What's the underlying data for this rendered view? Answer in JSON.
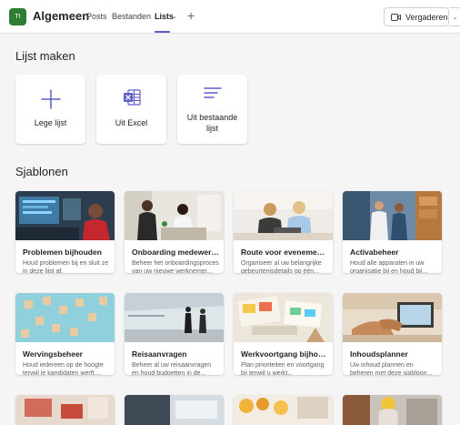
{
  "header": {
    "team_initials": "Tt",
    "channel_name": "Algemeen",
    "tabs": [
      "Posts",
      "Bestanden",
      "Lists"
    ],
    "meet_label": "Vergaderen"
  },
  "create": {
    "title": "Lijst maken",
    "options": [
      {
        "label": "Lege lijst",
        "icon": "plus-icon"
      },
      {
        "label": "Uit Excel",
        "icon": "excel-icon"
      },
      {
        "label": "Uit bestaande lijst",
        "icon": "list-icon"
      }
    ]
  },
  "templates": {
    "title": "Sjablonen",
    "items": [
      {
        "title": "Problemen bijhouden",
        "desc": "Houd problemen bij en sluit ze in deze lijst af."
      },
      {
        "title": "Onboarding medewerk...",
        "desc": "Beheer het onboardingsproces van uw nieuwe werknemer..."
      },
      {
        "title": "Route voor evenement...",
        "desc": "Organiseer al uw belangrijke gebeurtenisdetails op één..."
      },
      {
        "title": "Activabeheer",
        "desc": "Houd alle apparaten in uw organisatie bij en houd bij..."
      },
      {
        "title": "Wervingsbeheer",
        "desc": "Houd iedereen op de hoogte terwijl je kandidaten werft,..."
      },
      {
        "title": "Reisaanvragen",
        "desc": "Beheer al uw reisaanvragen en houd budgetten in de..."
      },
      {
        "title": "Werkvoortgang bijhou...",
        "desc": "Plan prioriteiten en voortgang bij terwijl u werkt..."
      },
      {
        "title": "Inhoudsplanner",
        "desc": "Uw inhoud plannen en beheren met deze sjabloon..."
      }
    ]
  },
  "colors": {
    "accent": "#5b5fc7",
    "team": "#2e7d32",
    "excel": "#5b5fc7"
  }
}
